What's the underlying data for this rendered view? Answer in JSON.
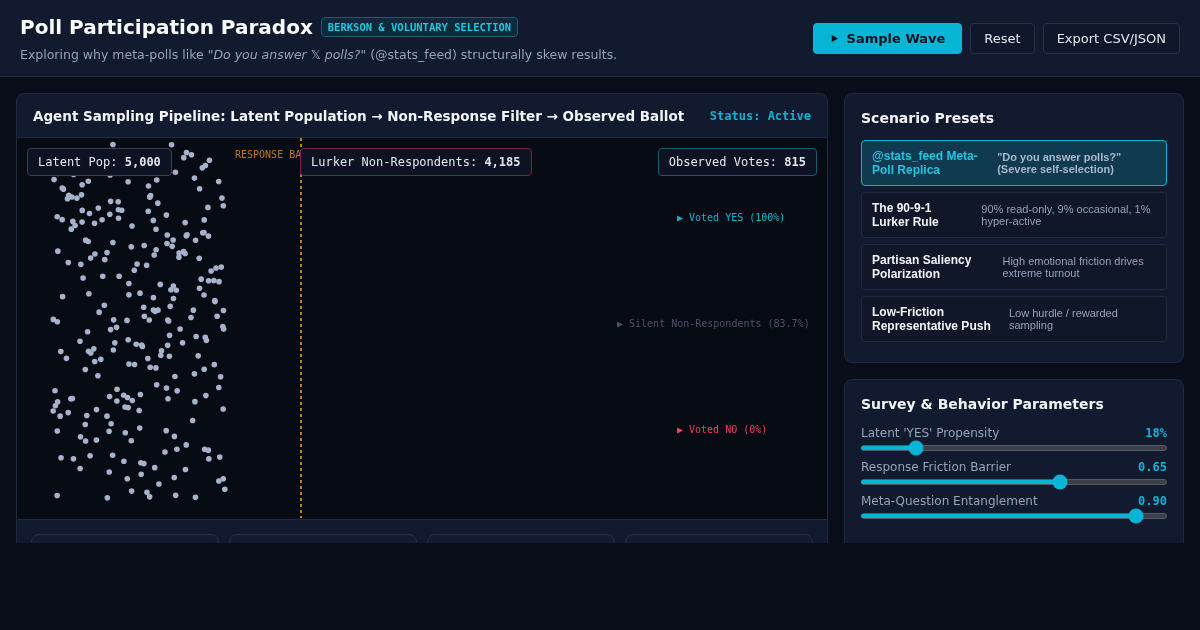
{
  "header": {
    "title": "Poll Participation Paradox",
    "badge": "BERKSON & VOLUNTARY SELECTION",
    "subtitle": "Exploring why meta-polls like \"*Do you answer 𝕏 polls?*\" (@stats_feed) structurally skew results.",
    "buttons": [
      {
        "label": "Sample Wave",
        "kind": "primary"
      },
      {
        "label": "Reset",
        "kind": "plain"
      },
      {
        "label": "Export CSV/JSON",
        "kind": "plain"
      }
    ]
  },
  "pipeline": {
    "title": "Agent Sampling Pipeline: Latent Population → Non-Response Filter → Observed Ballot",
    "status": "Status: Active",
    "barrier_label": "RESPONSE BA",
    "counters": [
      {
        "label": "Latent Pop:",
        "value": "5,000",
        "color": "#334155"
      },
      {
        "label": "Lurker Non-Respondents:",
        "value": "4,185",
        "color": "#7f1d3a"
      },
      {
        "label": "Observed Votes:",
        "value": "815",
        "color": "#155e75"
      }
    ],
    "outcomes": [
      {
        "label": "▶ Voted YES (100%)",
        "color": "#06b6d4"
      },
      {
        "label": "▶ Silent Non-Respondents (83.7%)",
        "color": "#475569"
      },
      {
        "label": "▶ Voted NO (0%)",
        "color": "#f43f5e"
      }
    ]
  },
  "presets": {
    "title": "Scenario Presets",
    "items": [
      {
        "name": "@stats_feed Meta-Poll Replica",
        "description": "\"Do you answer polls?\" (Severe self-selection)",
        "selected": true
      },
      {
        "name": "The 90-9-1 Lurker Rule",
        "description": "90% read-only, 9% occasional, 1% hyper-active",
        "selected": false
      },
      {
        "name": "Partisan Saliency Polarization",
        "description": "High emotional friction drives extreme turnout",
        "selected": false
      },
      {
        "name": "Low-Friction Representative Push",
        "description": "Low hurdle / rewarded sampling",
        "selected": false
      }
    ]
  },
  "parameters": {
    "title": "Survey & Behavior Parameters",
    "sliders": [
      {
        "label": "Latent 'YES' Propensity",
        "reading": "18%",
        "level": 0.18
      },
      {
        "label": "Response Friction Barrier",
        "reading": "0.65",
        "level": 0.65
      },
      {
        "label": "Meta-Question Entanglement",
        "reading": "0.90",
        "level": 0.9
      }
    ]
  }
}
